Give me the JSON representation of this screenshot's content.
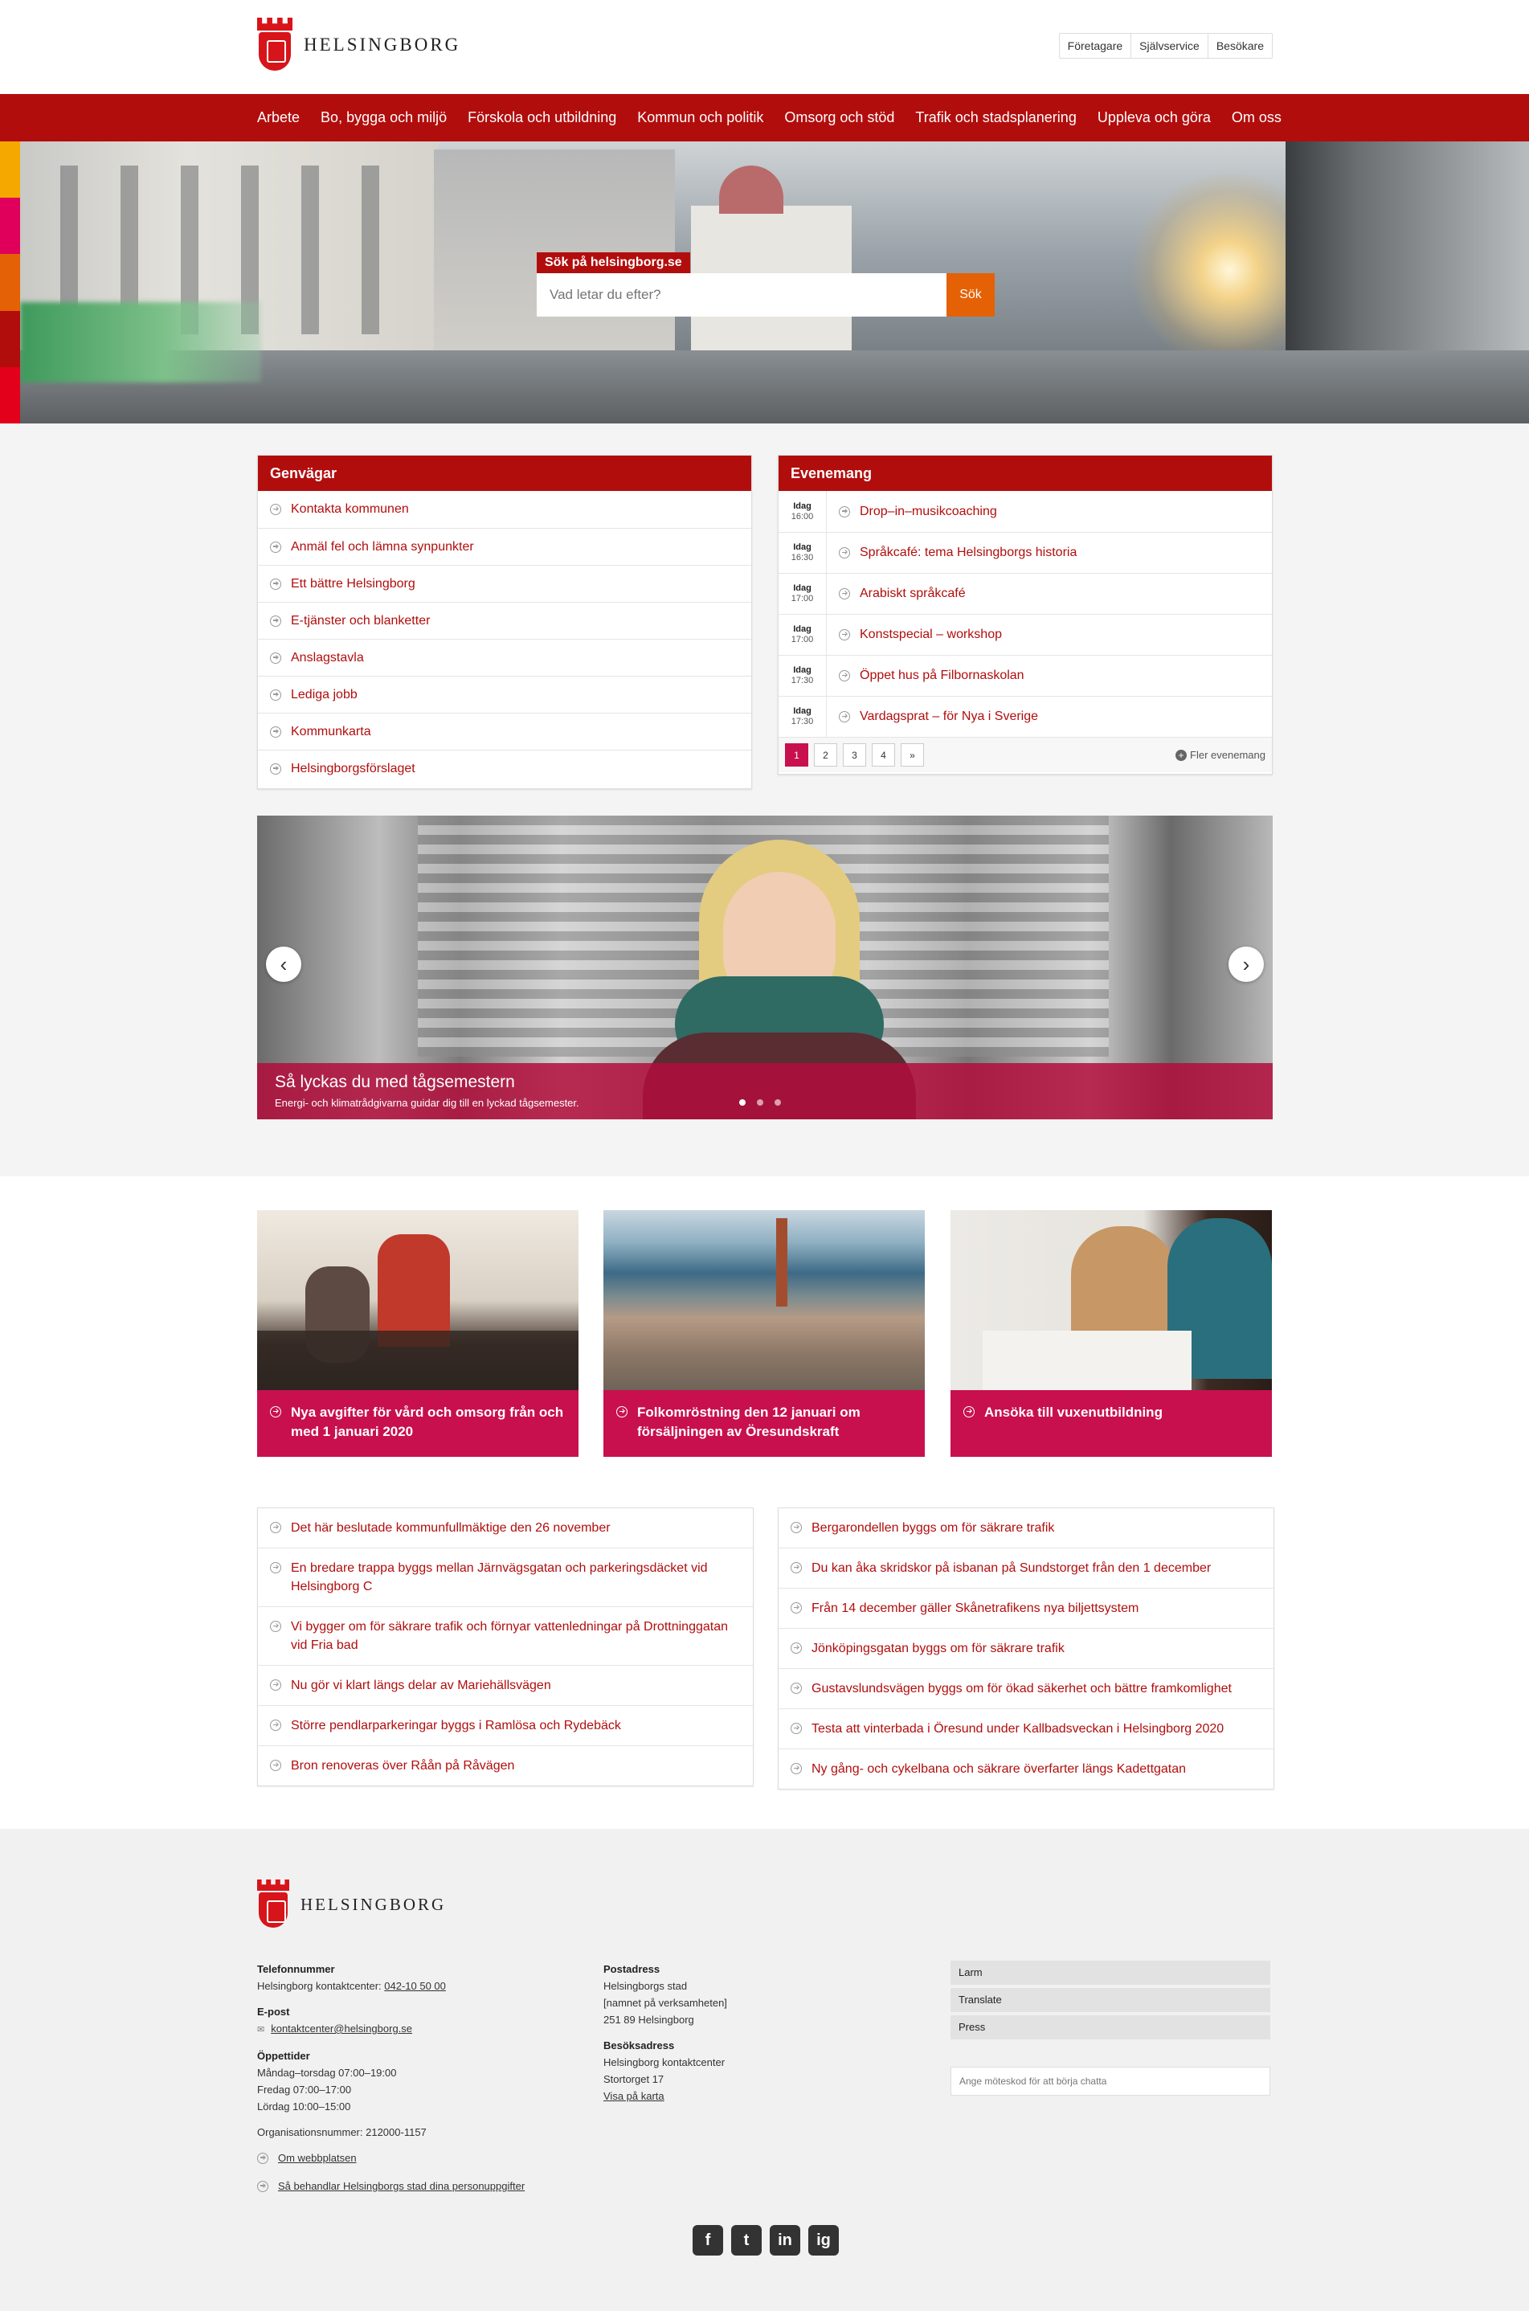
{
  "header": {
    "logo_text": "HELSINGBORG",
    "top_links": [
      "Företagare",
      "Självservice",
      "Besökare"
    ]
  },
  "main_nav": [
    "Arbete",
    "Bo, bygga och miljö",
    "Förskola och utbildning",
    "Kommun och politik",
    "Omsorg och stöd",
    "Trafik och stadsplanering",
    "Uppleva och göra",
    "Om oss"
  ],
  "hero": {
    "stripe_colors": [
      "#f5a800",
      "#e0005b",
      "#e46106",
      "#b20d0d",
      "#e2001a"
    ]
  },
  "search": {
    "label": "Sök på helsingborg.se",
    "placeholder": "Vad letar du efter?",
    "button": "Sök"
  },
  "shortcuts": {
    "title": "Genvägar",
    "items": [
      "Kontakta kommunen",
      "Anmäl fel och lämna synpunkter",
      "Ett bättre Helsingborg",
      "E-tjänster och blanketter",
      "Anslagstavla",
      "Lediga jobb",
      "Kommunkarta",
      "Helsingborgsförslaget"
    ]
  },
  "events": {
    "title": "Evenemang",
    "items": [
      {
        "day": "Idag",
        "time": "16:00",
        "title": "Drop–in–musikcoaching"
      },
      {
        "day": "Idag",
        "time": "16:30",
        "title": "Språkcafé: tema Helsingborgs historia"
      },
      {
        "day": "Idag",
        "time": "17:00",
        "title": "Arabiskt språkcafé"
      },
      {
        "day": "Idag",
        "time": "17:00",
        "title": "Konstspecial – workshop"
      },
      {
        "day": "Idag",
        "time": "17:30",
        "title": "Öppet hus på Filbornaskolan"
      },
      {
        "day": "Idag",
        "time": "17:30",
        "title": "Vardagsprat – för Nya i Sverige"
      }
    ],
    "pages": [
      "1",
      "2",
      "3",
      "4",
      "»"
    ],
    "more": "Fler evenemang"
  },
  "carousel": {
    "title": "Så lyckas du med tågsemestern",
    "subtitle": "Energi- och klimatrådgivarna guidar dig till en lyckad tågsemester.",
    "prev": "‹",
    "next": "›"
  },
  "cards": [
    {
      "title": "Nya avgifter för vård och omsorg från och med 1 januari 2020"
    },
    {
      "title": "Folkomröstning den 12 januari om försäljningen av Öresundskraft"
    },
    {
      "title": "Ansöka till vuxenutbildning"
    }
  ],
  "news_left": [
    "Det här beslutade kommunfullmäktige den 26 november",
    "En bredare trappa byggs mellan Järnvägsgatan och parkeringsdäcket vid Helsingborg C",
    "Vi bygger om för säkrare trafik och förnyar vattenledningar på Drottninggatan vid Fria bad",
    "Nu gör vi klart längs delar av Mariehällsvägen",
    "Större pendlarparkeringar byggs i Ramlösa och Rydebäck",
    "Bron renoveras över Råån på Råvägen"
  ],
  "news_right": [
    "Bergarondellen byggs om för säkrare trafik",
    "Du kan åka skridskor på isbanan på Sundstorget från den 1 december",
    "Från 14 december gäller Skånetrafikens nya biljettsystem",
    "Jönköpingsgatan byggs om för säkrare trafik",
    "Gustavslundsvägen byggs om för ökad säkerhet och bättre framkomlighet",
    "Testa att vinterbada i Öresund under Kallbadsveckan i Helsingborg 2020",
    "Ny gång- och cykelbana och säkrare överfarter längs Kadettgatan"
  ],
  "footer": {
    "logo_text": "HELSINGBORG",
    "phone_heading": "Telefonnummer",
    "phone_text": "Helsingborg kontaktcenter: ",
    "phone_number": "042-10 50 00",
    "email_heading": "E-post",
    "email": "kontaktcenter@helsingborg.se",
    "hours_heading": "Öppettider",
    "hours": [
      "Måndag–torsdag 07:00–19:00",
      "Fredag 07:00–17:00",
      "Lördag 10:00–15:00"
    ],
    "org_number": "Organisationsnummer: 212000-1157",
    "about_link": "Om webbplatsen",
    "privacy_link": "Så behandlar Helsingborgs stad dina personuppgifter",
    "postal_heading": "Postadress",
    "postal": [
      "Helsingborgs stad",
      "[namnet på verksamheten]",
      "251 89 Helsingborg"
    ],
    "visit_heading": "Besöksadress",
    "visit": [
      "Helsingborg kontaktcenter",
      "Stortorget 17"
    ],
    "map_link": "Visa på karta",
    "buttons": [
      "Larm",
      "Translate",
      "Press"
    ],
    "chat_placeholder": "Ange möteskod för att börja chatta",
    "social": [
      "f",
      "t",
      "in",
      "ig"
    ]
  }
}
